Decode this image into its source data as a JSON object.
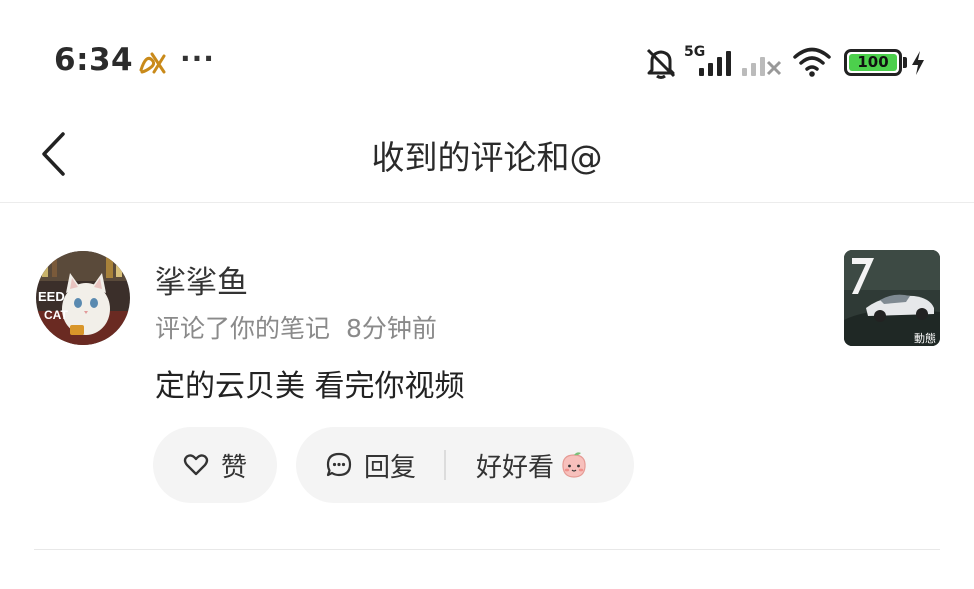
{
  "status_bar": {
    "time": "6:34",
    "more": "···",
    "network_label": "5G",
    "battery_level": "100"
  },
  "nav": {
    "title": "收到的评论和@"
  },
  "comment": {
    "username": "挲挲鱼",
    "action": "评论了你的笔记",
    "time_ago": "8分钟前",
    "text": "定的云贝美 看完你视频",
    "avatar_text": [
      "EED",
      "CAT"
    ],
    "thumb_badge": "動態"
  },
  "actions": {
    "like_label": "赞",
    "reply_label": "回复",
    "quick_reply_label": "好好看"
  },
  "colors": {
    "battery_fill": "#4cd04c",
    "pill_bg": "#f4f4f4",
    "meta_text": "#8a8a8a"
  }
}
